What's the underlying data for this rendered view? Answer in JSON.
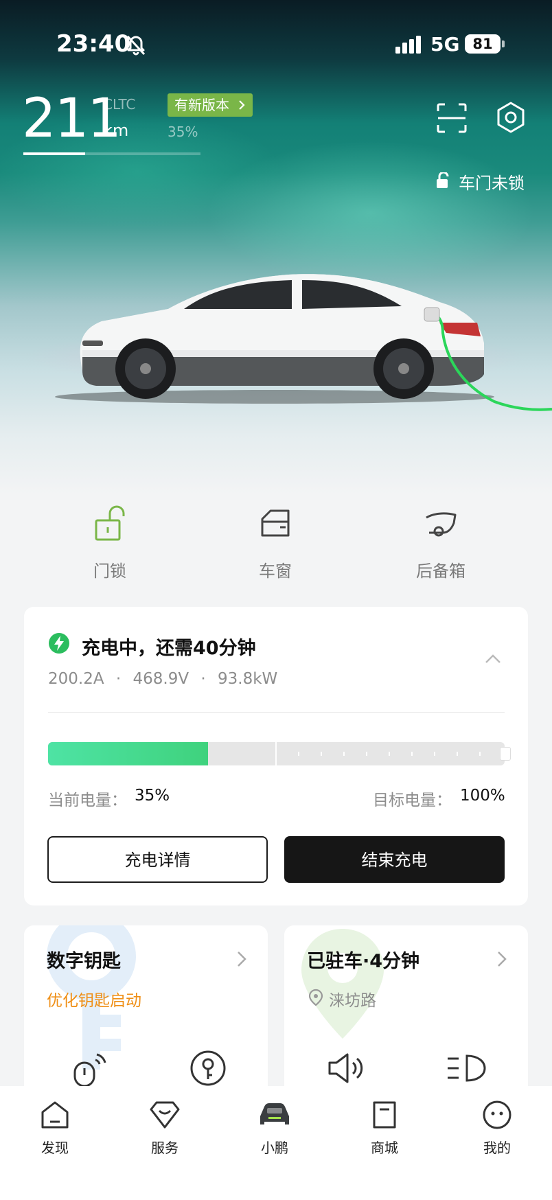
{
  "status_bar": {
    "time": "23:40",
    "network": "5G",
    "battery": "81"
  },
  "range": {
    "value": "211",
    "standard": "CLTC",
    "unit": "km",
    "update_badge": "有新版本",
    "battery_percent_label": "35%",
    "battery_fraction": 0.35
  },
  "door_status": "车门未锁",
  "quick_controls": [
    {
      "label": "门锁",
      "icon": "unlock-icon"
    },
    {
      "label": "车窗",
      "icon": "window-icon"
    },
    {
      "label": "后备箱",
      "icon": "trunk-icon"
    }
  ],
  "charging": {
    "title": "充电中，还需40分钟",
    "current": "200.2A",
    "voltage": "468.9V",
    "power": "93.8kW",
    "separator": "·",
    "current_label": "当前电量：",
    "current_value": "35%",
    "current_fraction": 0.35,
    "target_label": "目标电量：",
    "target_value": "100%",
    "target_fraction": 1.0,
    "detail_button": "充电详情",
    "stop_button": "结束充电"
  },
  "key_card": {
    "title": "数字钥匙",
    "subtitle": "优化钥匙启动",
    "accent": "#ef8f16"
  },
  "park_card": {
    "title": "已驻车·4分钟",
    "location": "涞坊路"
  },
  "bottom_nav": [
    {
      "label": "发现",
      "icon": "discover-icon"
    },
    {
      "label": "服务",
      "icon": "service-icon"
    },
    {
      "label": "小鹏",
      "icon": "car-icon",
      "active": true
    },
    {
      "label": "商城",
      "icon": "mall-icon"
    },
    {
      "label": "我的",
      "icon": "profile-icon"
    }
  ],
  "colors": {
    "brand_green": "#7ab648",
    "charge_green": "#3fd27d",
    "dark_button": "#161616"
  }
}
